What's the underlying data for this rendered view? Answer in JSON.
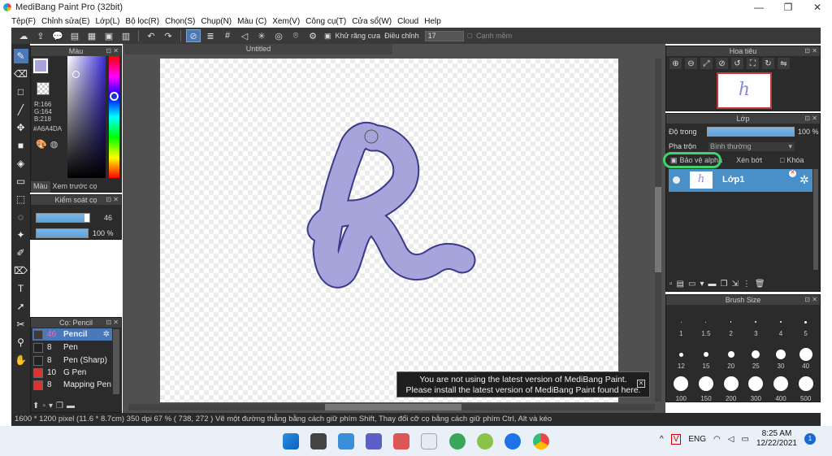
{
  "window": {
    "title": "MediBang Paint Pro (32bit)",
    "minimize": "—",
    "maximize": "❐",
    "close": "✕"
  },
  "menu": [
    "Tệp(F)",
    "Chỉnh sửa(E)",
    "Lớp(L)",
    "Bộ lọc(R)",
    "Chọn(S)",
    "Chụp(N)",
    "Màu (C)",
    "Xem(V)",
    "Công cụ(T)",
    "Cửa sổ(W)",
    "Cloud",
    "Help"
  ],
  "toolbar": {
    "antialias_label": "Khử răng cưa",
    "adjust_label": "Điều chỉnh",
    "adjust_value": "17",
    "edge_label": "Cạnh mềm"
  },
  "color_panel": {
    "title": "Màu",
    "r": "R:166",
    "g": "G:164",
    "b": "B:218",
    "hex": "#A6A4DA",
    "fg_color": "#A6A4DA",
    "tab_color": "Màu",
    "tab_preview": "Xem trước cọ"
  },
  "brush_control": {
    "title": "Kiểm soát cọ",
    "size_value": "46",
    "opacity_value": "100 %",
    "size_fraction": 0.9,
    "opacity_fraction": 1.0
  },
  "brush_list": {
    "title": "Cọ: Pencil",
    "items": [
      {
        "size": "46",
        "name": "Pencil",
        "color": "#3a3a3a",
        "selected": true
      },
      {
        "size": "8",
        "name": "Pen",
        "color": "#222222"
      },
      {
        "size": "8",
        "name": "Pen (Sharp)",
        "color": "#222222"
      },
      {
        "size": "10",
        "name": "G Pen",
        "color": "#e03030"
      },
      {
        "size": "8",
        "name": "Mapping Pen",
        "color": "#e03030"
      }
    ]
  },
  "document": {
    "tab": "Untitled",
    "stroke_color": "#A6A4DA",
    "outline_color": "#3a3a8a"
  },
  "toast": {
    "line1": "You are not using the latest version of MediBang Paint.",
    "line2": "Please install the latest version of MediBang Paint found here.",
    "close": "✕"
  },
  "navigator": {
    "title": "Hoa tiêu"
  },
  "layer_panel": {
    "title": "Lớp",
    "opacity_label": "Độ trong",
    "opacity_value": "100 %",
    "blend_label": "Pha trộn",
    "blend_value": "Bình thường",
    "alpha_label": "Bảo vệ alpha",
    "clip_label": "Xén bớt",
    "lock_label": "Khóa",
    "layer_name": "Lớp1"
  },
  "brush_size": {
    "title": "Brush Size",
    "sizes": [
      "1",
      "1.5",
      "2",
      "3",
      "4",
      "5",
      "12",
      "15",
      "20",
      "25",
      "30",
      "40",
      "100",
      "150",
      "200",
      "300",
      "400",
      "500"
    ]
  },
  "status": {
    "text": "1600 * 1200 pixel   (11.6 * 8.7cm)   350 dpi   67 %   ( 738, 272 )   Vẽ một đường thẳng bằng cách giữ phím Shift, Thay đổi cỡ cọ bằng cách giữ phím Ctrl, Alt và kéo"
  },
  "taskbar": {
    "lang": "ENG",
    "time": "8:25 AM",
    "date": "12/22/2021",
    "notifications": "1"
  }
}
